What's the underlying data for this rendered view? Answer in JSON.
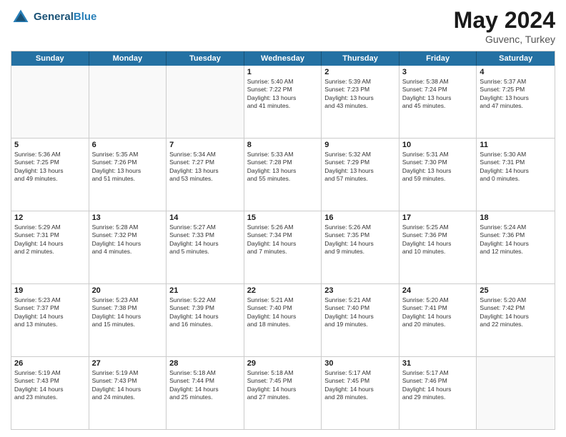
{
  "header": {
    "logo_general": "General",
    "logo_blue": "Blue",
    "month_year": "May 2024",
    "location": "Guvenc, Turkey"
  },
  "days_of_week": [
    "Sunday",
    "Monday",
    "Tuesday",
    "Wednesday",
    "Thursday",
    "Friday",
    "Saturday"
  ],
  "weeks": [
    [
      {
        "day": "",
        "info": ""
      },
      {
        "day": "",
        "info": ""
      },
      {
        "day": "",
        "info": ""
      },
      {
        "day": "1",
        "info": "Sunrise: 5:40 AM\nSunset: 7:22 PM\nDaylight: 13 hours\nand 41 minutes."
      },
      {
        "day": "2",
        "info": "Sunrise: 5:39 AM\nSunset: 7:23 PM\nDaylight: 13 hours\nand 43 minutes."
      },
      {
        "day": "3",
        "info": "Sunrise: 5:38 AM\nSunset: 7:24 PM\nDaylight: 13 hours\nand 45 minutes."
      },
      {
        "day": "4",
        "info": "Sunrise: 5:37 AM\nSunset: 7:25 PM\nDaylight: 13 hours\nand 47 minutes."
      }
    ],
    [
      {
        "day": "5",
        "info": "Sunrise: 5:36 AM\nSunset: 7:25 PM\nDaylight: 13 hours\nand 49 minutes."
      },
      {
        "day": "6",
        "info": "Sunrise: 5:35 AM\nSunset: 7:26 PM\nDaylight: 13 hours\nand 51 minutes."
      },
      {
        "day": "7",
        "info": "Sunrise: 5:34 AM\nSunset: 7:27 PM\nDaylight: 13 hours\nand 53 minutes."
      },
      {
        "day": "8",
        "info": "Sunrise: 5:33 AM\nSunset: 7:28 PM\nDaylight: 13 hours\nand 55 minutes."
      },
      {
        "day": "9",
        "info": "Sunrise: 5:32 AM\nSunset: 7:29 PM\nDaylight: 13 hours\nand 57 minutes."
      },
      {
        "day": "10",
        "info": "Sunrise: 5:31 AM\nSunset: 7:30 PM\nDaylight: 13 hours\nand 59 minutes."
      },
      {
        "day": "11",
        "info": "Sunrise: 5:30 AM\nSunset: 7:31 PM\nDaylight: 14 hours\nand 0 minutes."
      }
    ],
    [
      {
        "day": "12",
        "info": "Sunrise: 5:29 AM\nSunset: 7:31 PM\nDaylight: 14 hours\nand 2 minutes."
      },
      {
        "day": "13",
        "info": "Sunrise: 5:28 AM\nSunset: 7:32 PM\nDaylight: 14 hours\nand 4 minutes."
      },
      {
        "day": "14",
        "info": "Sunrise: 5:27 AM\nSunset: 7:33 PM\nDaylight: 14 hours\nand 5 minutes."
      },
      {
        "day": "15",
        "info": "Sunrise: 5:26 AM\nSunset: 7:34 PM\nDaylight: 14 hours\nand 7 minutes."
      },
      {
        "day": "16",
        "info": "Sunrise: 5:26 AM\nSunset: 7:35 PM\nDaylight: 14 hours\nand 9 minutes."
      },
      {
        "day": "17",
        "info": "Sunrise: 5:25 AM\nSunset: 7:36 PM\nDaylight: 14 hours\nand 10 minutes."
      },
      {
        "day": "18",
        "info": "Sunrise: 5:24 AM\nSunset: 7:36 PM\nDaylight: 14 hours\nand 12 minutes."
      }
    ],
    [
      {
        "day": "19",
        "info": "Sunrise: 5:23 AM\nSunset: 7:37 PM\nDaylight: 14 hours\nand 13 minutes."
      },
      {
        "day": "20",
        "info": "Sunrise: 5:23 AM\nSunset: 7:38 PM\nDaylight: 14 hours\nand 15 minutes."
      },
      {
        "day": "21",
        "info": "Sunrise: 5:22 AM\nSunset: 7:39 PM\nDaylight: 14 hours\nand 16 minutes."
      },
      {
        "day": "22",
        "info": "Sunrise: 5:21 AM\nSunset: 7:40 PM\nDaylight: 14 hours\nand 18 minutes."
      },
      {
        "day": "23",
        "info": "Sunrise: 5:21 AM\nSunset: 7:40 PM\nDaylight: 14 hours\nand 19 minutes."
      },
      {
        "day": "24",
        "info": "Sunrise: 5:20 AM\nSunset: 7:41 PM\nDaylight: 14 hours\nand 20 minutes."
      },
      {
        "day": "25",
        "info": "Sunrise: 5:20 AM\nSunset: 7:42 PM\nDaylight: 14 hours\nand 22 minutes."
      }
    ],
    [
      {
        "day": "26",
        "info": "Sunrise: 5:19 AM\nSunset: 7:43 PM\nDaylight: 14 hours\nand 23 minutes."
      },
      {
        "day": "27",
        "info": "Sunrise: 5:19 AM\nSunset: 7:43 PM\nDaylight: 14 hours\nand 24 minutes."
      },
      {
        "day": "28",
        "info": "Sunrise: 5:18 AM\nSunset: 7:44 PM\nDaylight: 14 hours\nand 25 minutes."
      },
      {
        "day": "29",
        "info": "Sunrise: 5:18 AM\nSunset: 7:45 PM\nDaylight: 14 hours\nand 27 minutes."
      },
      {
        "day": "30",
        "info": "Sunrise: 5:17 AM\nSunset: 7:45 PM\nDaylight: 14 hours\nand 28 minutes."
      },
      {
        "day": "31",
        "info": "Sunrise: 5:17 AM\nSunset: 7:46 PM\nDaylight: 14 hours\nand 29 minutes."
      },
      {
        "day": "",
        "info": ""
      }
    ]
  ]
}
